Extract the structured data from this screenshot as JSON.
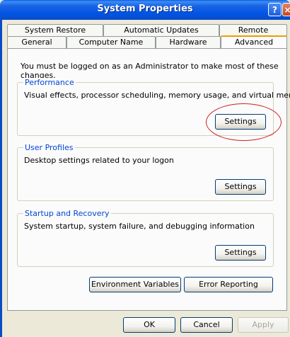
{
  "window": {
    "title": "System Properties"
  },
  "title_buttons": {
    "help": "?",
    "close": "×"
  },
  "tabs": {
    "row_back": [
      "System Restore",
      "Automatic Updates",
      "Remote"
    ],
    "row_front": [
      "General",
      "Computer Name",
      "Hardware",
      "Advanced"
    ],
    "active": "Advanced"
  },
  "advanced": {
    "admin_notice": "You must be logged on as an Administrator to make most of these changes.",
    "performance": {
      "legend": "Performance",
      "description": "Visual effects, processor scheduling, memory usage, and virtual memory",
      "button": "Settings"
    },
    "user_profiles": {
      "legend": "User Profiles",
      "description": "Desktop settings related to your logon",
      "button": "Settings"
    },
    "startup_recovery": {
      "legend": "Startup and Recovery",
      "description": "System startup, system failure, and debugging information",
      "button": "Settings"
    },
    "environment_variables": "Environment Variables",
    "error_reporting": "Error Reporting"
  },
  "dialog_buttons": {
    "ok": "OK",
    "cancel": "Cancel",
    "apply": "Apply"
  },
  "annotation_color": "#d02020"
}
